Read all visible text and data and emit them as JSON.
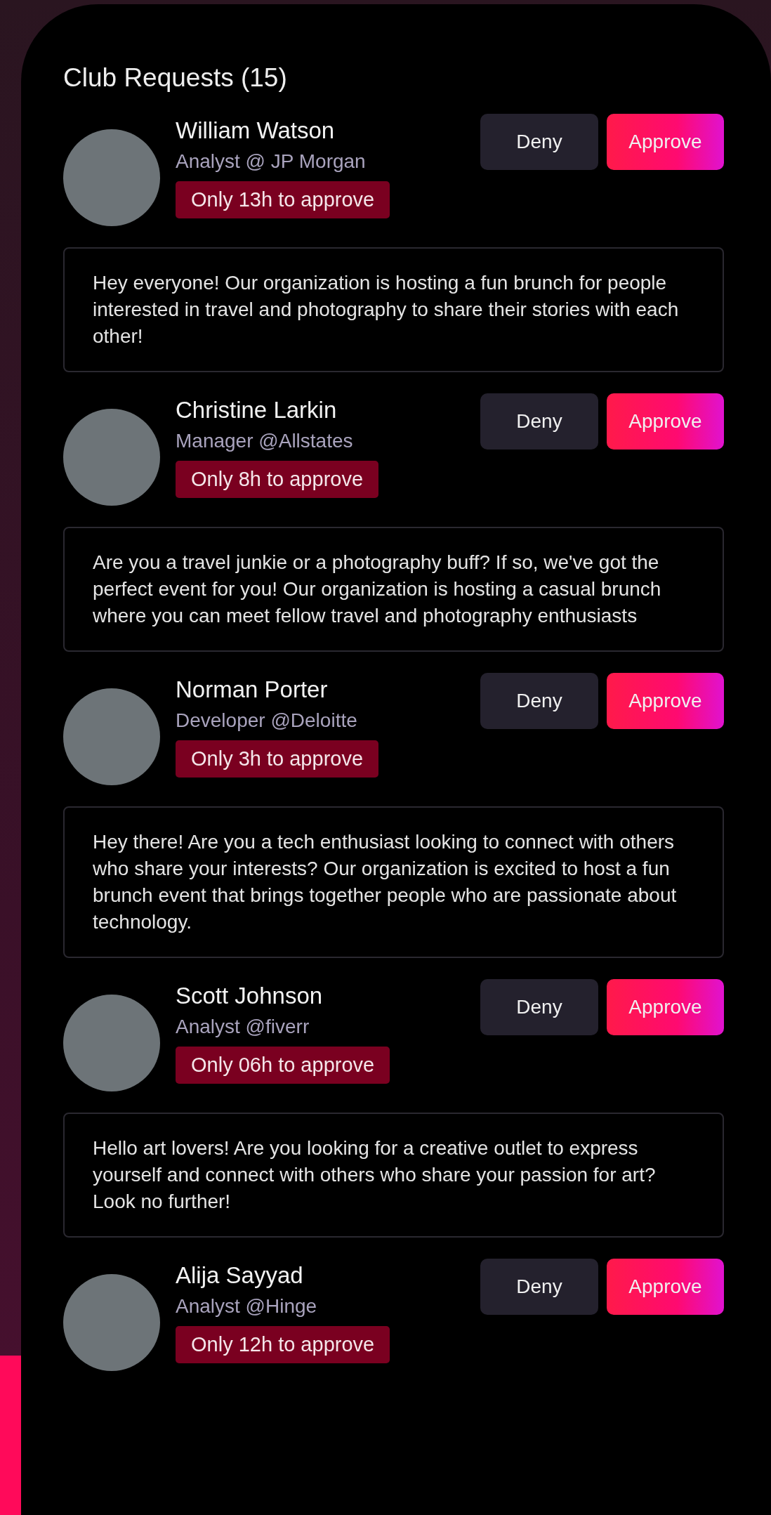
{
  "title": "Club Requests (15)",
  "requests": [
    {
      "name": "William Watson",
      "role": "Analyst @ JP Morgan",
      "deadline": "Only 13h to approve",
      "deny": "Deny",
      "approve": "Approve",
      "message": "Hey everyone! Our organization is hosting a fun brunch for people interested in travel and photography to share their stories with each other!"
    },
    {
      "name": "Christine Larkin",
      "role": "Manager @Allstates",
      "deadline": "Only 8h to approve",
      "deny": "Deny",
      "approve": "Approve",
      "message": "Are you a travel junkie or a photography buff? If so, we've got the perfect event for you! Our organization is hosting a casual brunch where you can meet fellow travel and photography enthusiasts"
    },
    {
      "name": "Norman Porter",
      "role": "Developer @Deloitte",
      "deadline": "Only 3h to approve",
      "deny": "Deny",
      "approve": "Approve",
      "message": "Hey there! Are you a tech enthusiast looking to connect with others who share your interests? Our organization is excited to host a fun brunch event that brings together people who are passionate about technology."
    },
    {
      "name": "Scott Johnson",
      "role": "Analyst @fiverr",
      "deadline": "Only 06h to approve",
      "deny": "Deny",
      "approve": "Approve",
      "message": "Hello art lovers! Are you looking for a creative outlet to express yourself and connect with others who share your passion for art? Look no further!"
    },
    {
      "name": "Alija Sayyad",
      "role": "Analyst @Hinge",
      "deadline": "Only 12h to approve",
      "deny": "Deny",
      "approve": "Approve"
    }
  ]
}
